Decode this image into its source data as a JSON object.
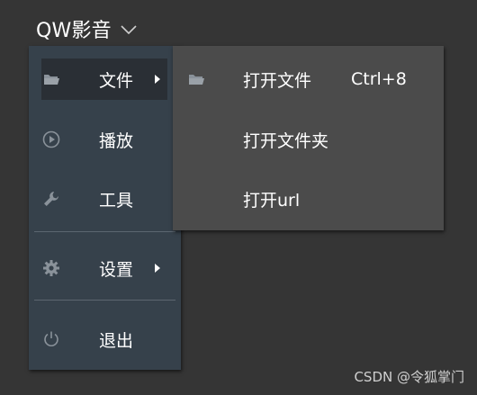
{
  "app": {
    "title": "QW影音"
  },
  "main_menu": {
    "items": [
      {
        "label": "文件",
        "icon": "folder-icon",
        "active": true,
        "has_submenu": true
      },
      {
        "label": "播放",
        "icon": "play-circle-icon",
        "active": false,
        "has_submenu": false
      },
      {
        "label": "工具",
        "icon": "wrench-icon",
        "active": false,
        "has_submenu": false
      },
      {
        "label": "设置",
        "icon": "gear-icon",
        "active": false,
        "has_submenu": true
      },
      {
        "label": "退出",
        "icon": "power-icon",
        "active": false,
        "has_submenu": false
      }
    ]
  },
  "sub_menu": {
    "items": [
      {
        "label": "打开文件",
        "shortcut": "Ctrl+8",
        "icon": "folder-icon"
      },
      {
        "label": "打开文件夹",
        "shortcut": ""
      },
      {
        "label": "打开url",
        "shortcut": ""
      }
    ]
  },
  "watermark": "CSDN @令狐掌门",
  "colors": {
    "background": "#353535",
    "main_menu_bg": "#36414b",
    "main_menu_active_bg": "#2a2f35",
    "sub_menu_bg": "#4b4b4b",
    "icon_gray": "#8a929a",
    "text": "#ffffff"
  }
}
